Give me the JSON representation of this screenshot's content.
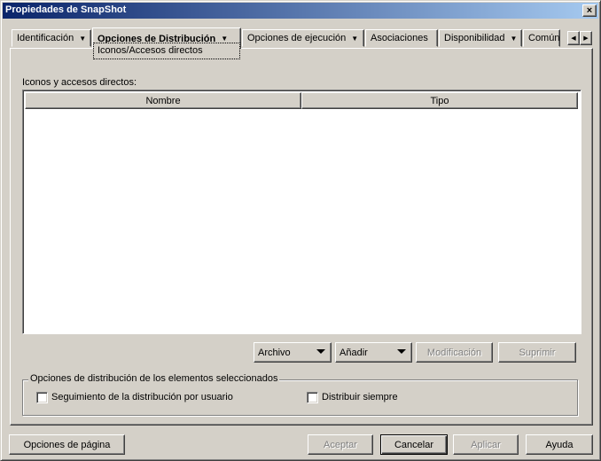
{
  "window": {
    "title": "Propiedades de SnapShot",
    "close_glyph": "×"
  },
  "tabs": [
    {
      "label": "Identificación",
      "arrow": "▼"
    },
    {
      "label": "Opciones de Distribución",
      "arrow": "▼",
      "active": true
    },
    {
      "label": "Opciones de ejecución",
      "arrow": "▼"
    },
    {
      "label": "Asociaciones"
    },
    {
      "label": "Disponibilidad",
      "arrow": "▼"
    },
    {
      "label": "Común"
    }
  ],
  "active_subtab": "Iconos/Accesos directos",
  "tab_scroll": {
    "left": "◀",
    "right": "▶"
  },
  "list": {
    "label": "Iconos y accesos directos:",
    "columns": [
      "Nombre",
      "Tipo"
    ],
    "rows": []
  },
  "actions": {
    "archivo": "Archivo",
    "anadir": "Añadir",
    "modificacion": "Modificación",
    "suprimir": "Suprimir"
  },
  "group": {
    "title": "Opciones de distribución de los elementos seleccionados",
    "track_label": "Seguimiento de la distribución por usuario",
    "track_checked": false,
    "always_label": "Distribuir siempre",
    "always_checked": false
  },
  "footer": {
    "page_options": "Opciones de página",
    "accept": "Aceptar",
    "cancel": "Cancelar",
    "apply": "Aplicar",
    "help": "Ayuda"
  },
  "colors": {
    "face": "#d4d0c8",
    "title_start": "#0a246a",
    "title_end": "#a6caf0",
    "disabled_text": "#808080"
  }
}
